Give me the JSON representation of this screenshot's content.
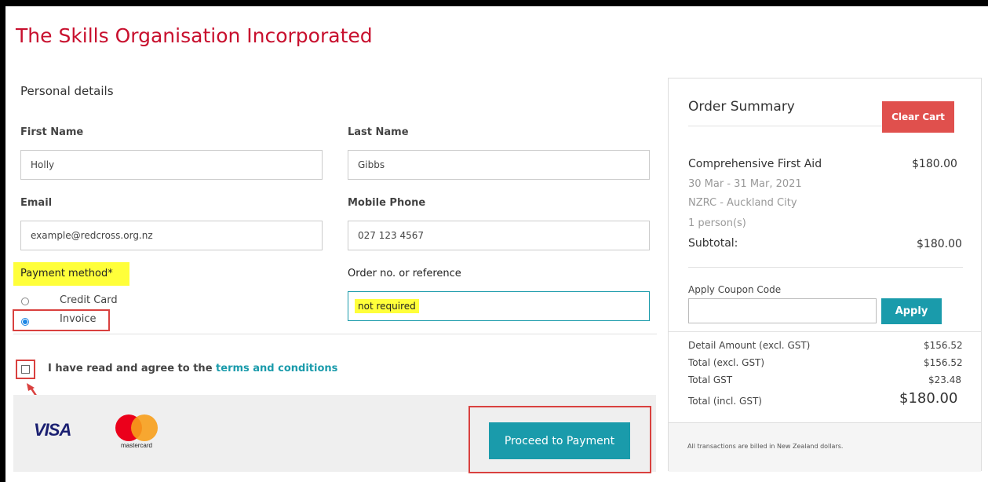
{
  "org_title": "The Skills Organisation Incorporated",
  "personal": {
    "heading": "Personal details",
    "first_name_label": "First Name",
    "first_name_value": "Holly",
    "last_name_label": "Last Name",
    "last_name_value": "Gibbs",
    "email_label": "Email",
    "email_value": "example@redcross.org.nz",
    "mobile_label": "Mobile Phone",
    "mobile_value": "027 123 4567"
  },
  "payment": {
    "label": "Payment method*",
    "options": [
      {
        "label": "Credit Card",
        "selected": false
      },
      {
        "label": "Invoice",
        "selected": true
      }
    ],
    "reference_label": "Order no. or reference",
    "reference_value": "not required"
  },
  "terms": {
    "prefix": "I have read and agree to the ",
    "link": "terms and conditions"
  },
  "logos": {
    "visa": "VISA",
    "mastercard": "mastercard"
  },
  "proceed_label": "Proceed to Payment",
  "summary": {
    "heading": "Order Summary",
    "clear_label": "Clear Cart",
    "course": "Comprehensive First Aid",
    "course_price": "$180.00",
    "dates": "30 Mar - 31 Mar, 2021",
    "location": "NZRC - Auckland City",
    "persons": "1 person(s)",
    "subtotal_label": "Subtotal:",
    "subtotal_value": "$180.00",
    "coupon_label": "Apply Coupon Code",
    "coupon_value": "",
    "apply_label": "Apply",
    "detail_label": "Detail Amount (excl. GST)",
    "detail_value": "$156.52",
    "total_excl_label": "Total (excl. GST)",
    "total_excl_value": "$156.52",
    "gst_label": "Total GST",
    "gst_value": "$23.48",
    "total_incl_label": "Total (incl. GST)",
    "total_incl_value": "$180.00",
    "footer_note": "All transactions are billed in New Zealand dollars."
  },
  "colors": {
    "brand_red": "#c8102e",
    "teal": "#1a9bab",
    "highlight": "#ffff3a",
    "annotation_red": "#d9413f"
  }
}
